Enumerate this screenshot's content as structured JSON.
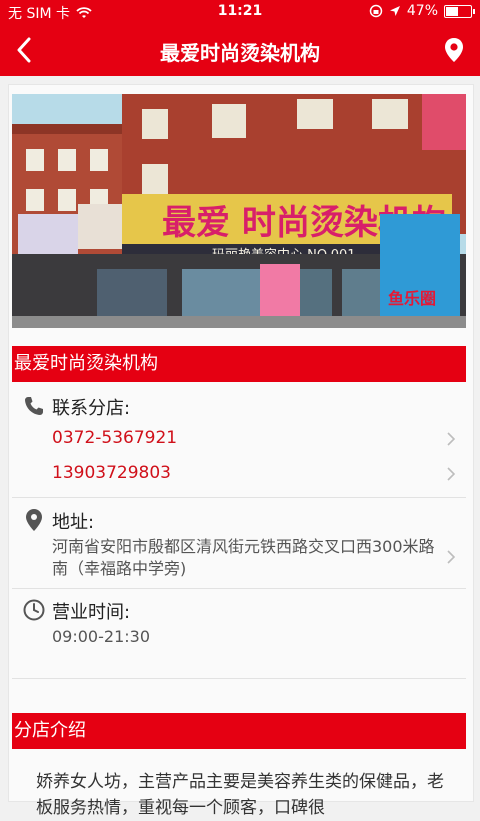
{
  "statusbar": {
    "carrier": "无 SIM 卡",
    "time": "11:21",
    "battery": "47%"
  },
  "header": {
    "title": "最爱时尚烫染机构"
  },
  "shop": {
    "photo_alt": "",
    "name": "最爱时尚烫染机构",
    "contact_label": "联系分店:",
    "phones": [
      "0372-5367921",
      "13903729803"
    ],
    "address_label": "地址:",
    "address": "河南省安阳市殷都区清风街元铁西路交叉口西300米路南（幸福路中学旁)",
    "hours_label": "营业时间:",
    "hours": "09:00-21:30"
  },
  "intro": {
    "title": "分店介绍",
    "text": "娇养女人坊，主营产品主要是美容养生类的保健品，老板服务热情，重视每一个顾客，口碑很"
  },
  "sign_text": {
    "main": "最爱 时尚烫染机构",
    "sub": "玛丽艳美容中心 NO.001",
    "side": "鱼乐圈"
  },
  "colors": {
    "accent": "#e50012",
    "phone": "#d0101a"
  }
}
